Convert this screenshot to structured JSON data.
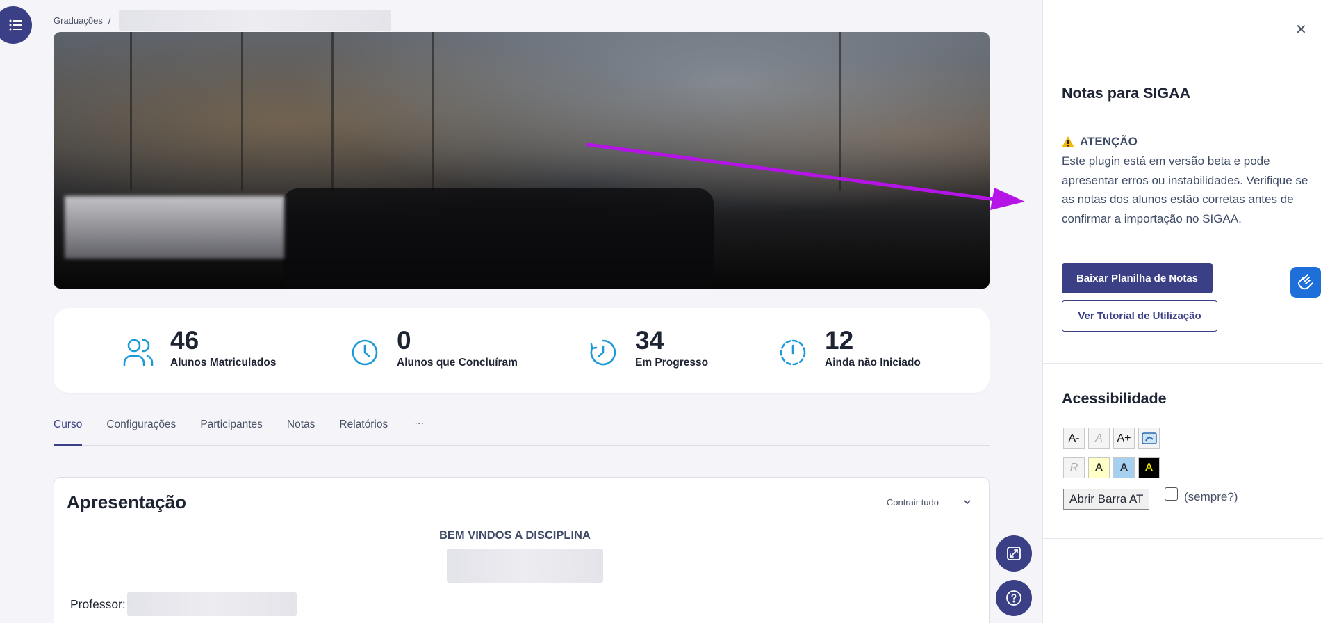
{
  "breadcrumb": {
    "root": "Graduações",
    "separator": "/"
  },
  "stats": [
    {
      "value": "46",
      "label": "Alunos Matriculados",
      "icon": "users-icon"
    },
    {
      "value": "0",
      "label": "Alunos que Concluíram",
      "icon": "clock-icon"
    },
    {
      "value": "34",
      "label": "Em Progresso",
      "icon": "progress-clock-icon"
    },
    {
      "value": "12",
      "label": "Ainda não Iniciado",
      "icon": "dashed-clock-icon"
    }
  ],
  "tabs": [
    "Curso",
    "Configurações",
    "Participantes",
    "Notas",
    "Relatórios"
  ],
  "tab_more": "···",
  "section": {
    "title": "Apresentação",
    "collapse_all": "Contrair tudo",
    "welcome": "BEM VINDOS A DISCIPLINA",
    "professor_label": "Professor:"
  },
  "drawer": {
    "title": "Notas para SIGAA",
    "attention_title": "ATENÇÃO",
    "attention_text": "Este plugin está em versão beta e pode apresentar erros ou instabilidades. Verifique se as notas dos alunos estão corretas antes de confirmar a importação no SIGAA.",
    "download_button": "Baixar Planilha de Notas",
    "tutorial_button": "Ver Tutorial de Utilização",
    "accessibility_title": "Acessibilidade",
    "acc_row1": [
      "A-",
      "A",
      "A+"
    ],
    "acc_row2": [
      "R",
      "A",
      "A",
      "A"
    ],
    "open_bar": "Abrir Barra AT",
    "always": "(sempre?)"
  },
  "colors": {
    "accent": "#3a3f86",
    "icon_blue": "#1a9bd7",
    "arrow": "#b414e6",
    "warning": "#f5b800"
  }
}
